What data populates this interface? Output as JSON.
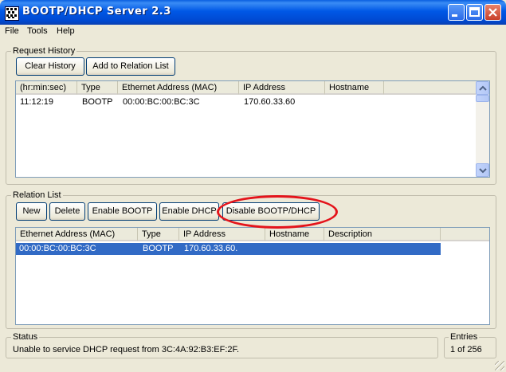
{
  "window": {
    "title": "BOOTP/DHCP Server 2.3"
  },
  "menu": [
    "File",
    "Tools",
    "Help"
  ],
  "request_history": {
    "label": "Request History",
    "buttons": {
      "clear": "Clear History",
      "add": "Add to Relation List"
    },
    "columns": [
      "(hr:min:sec)",
      "Type",
      "Ethernet Address (MAC)",
      "IP Address",
      "Hostname"
    ],
    "rows": [
      [
        "11:12:19",
        "BOOTP",
        "00:00:BC:00:BC:3C",
        "170.60.33.60",
        ""
      ]
    ]
  },
  "relation_list": {
    "label": "Relation List",
    "buttons": {
      "new": "New",
      "delete": "Delete",
      "enable_bootp": "Enable BOOTP",
      "enable_dhcp": "Enable DHCP",
      "disable": "Disable BOOTP/DHCP"
    },
    "columns": [
      "Ethernet Address (MAC)",
      "Type",
      "IP Address",
      "Hostname",
      "Description"
    ],
    "rows": [
      [
        "00:00:BC:00:BC:3C",
        "BOOTP",
        "170.60.33.60.",
        "",
        ""
      ]
    ]
  },
  "status": {
    "label": "Status",
    "message": "Unable to service DHCP request from 3C:4A:92:B3:EF:2F."
  },
  "entries": {
    "label": "Entries",
    "value": "1 of 256"
  },
  "colors": {
    "titlebar": "#0058e6",
    "selection": "#316ac5",
    "highlight_ellipse": "#e4141b"
  }
}
